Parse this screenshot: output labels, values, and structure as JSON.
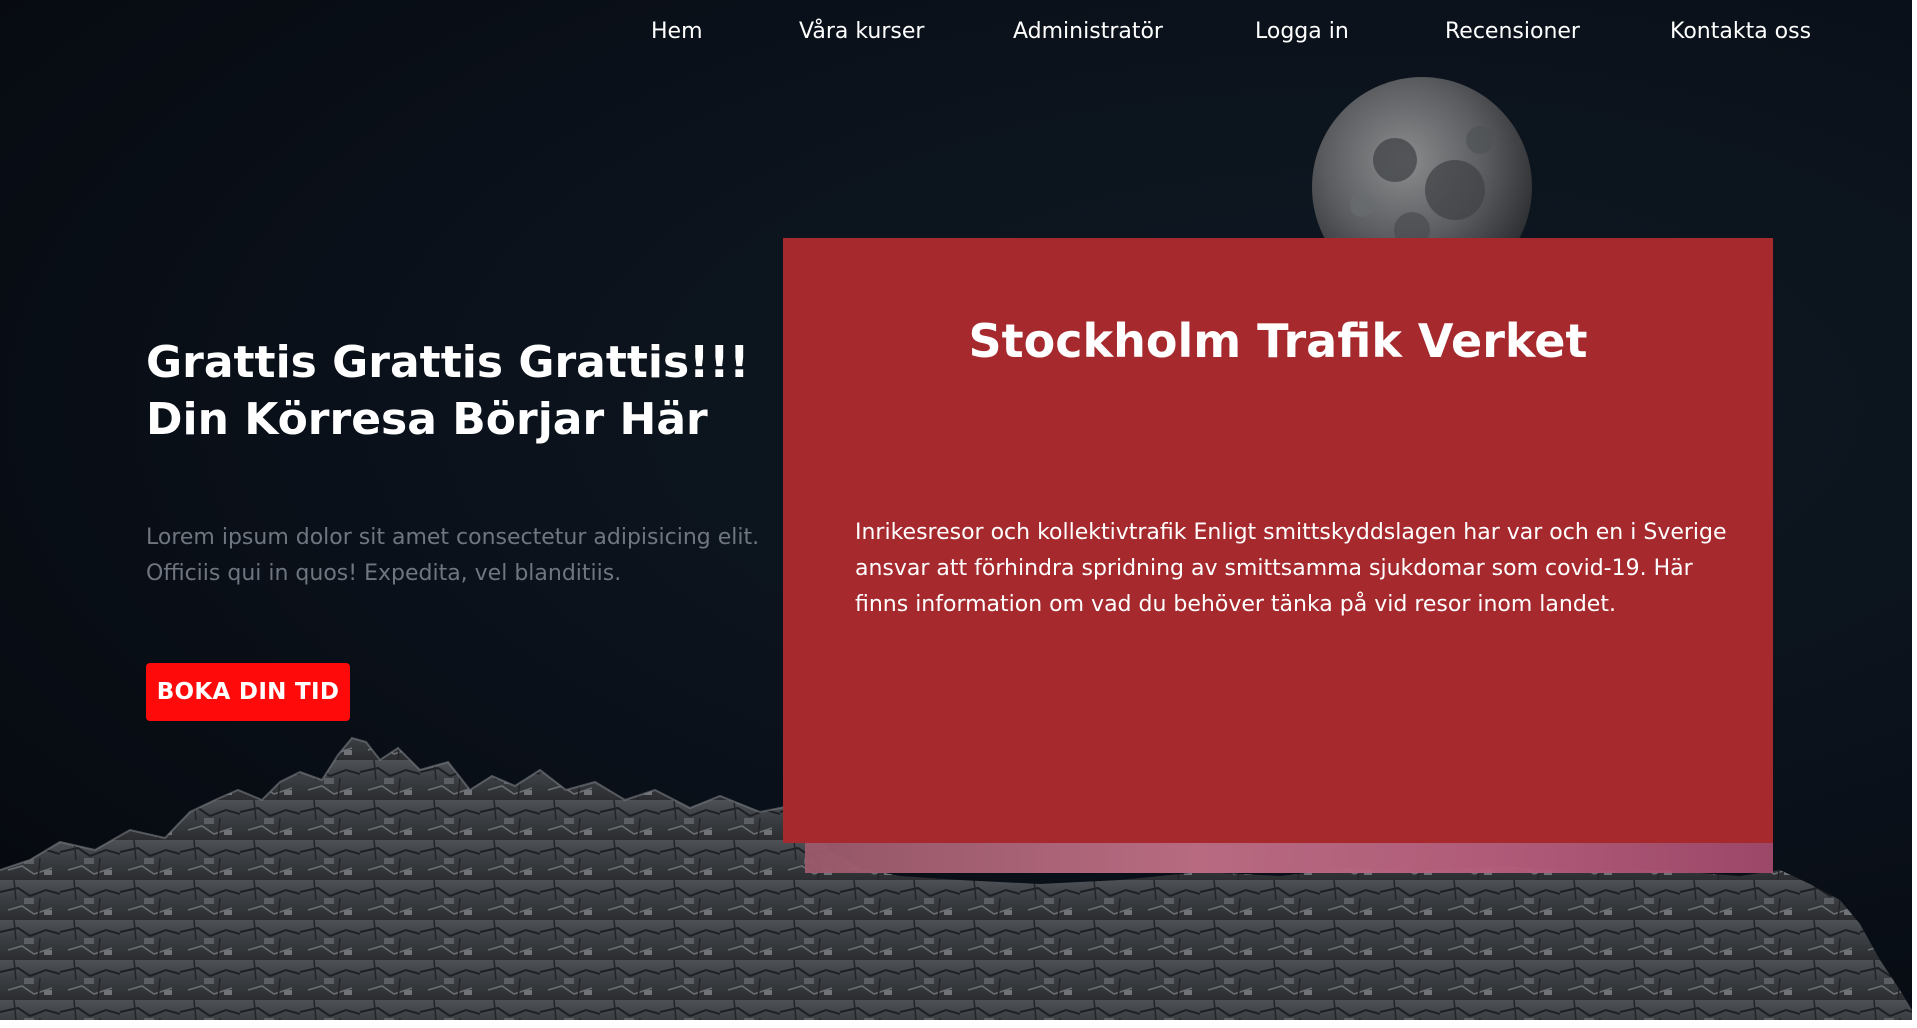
{
  "nav": {
    "items": [
      {
        "label": "Hem"
      },
      {
        "label": "Våra kurser"
      },
      {
        "label": "Administratör"
      },
      {
        "label": "Logga in"
      },
      {
        "label": "Recensioner"
      },
      {
        "label": "Kontakta oss"
      }
    ]
  },
  "hero": {
    "title_line1": "Grattis Grattis Grattis!!!",
    "title_line2": "Din Körresa Börjar Här",
    "text_line1": "Lorem ipsum dolor sit amet consectetur adipisicing elit.",
    "text_line2": "Officiis qui in quos! Expedita, vel blanditiis.",
    "button_label": "BOKA DIN TID"
  },
  "card": {
    "title": "Stockholm Trafik Verket",
    "text_line1": "Inrikesresor och kollektivtrafik Enligt smittskyddslagen har var och en i Sverige",
    "text_line2": "ansvar att förhindra spridning av smittsamma sjukdomar som covid-19. Här",
    "text_line3": "finns information om vad du behöver tänka på vid resor inom landet."
  },
  "colors": {
    "card_background": "#a6292e",
    "button_background": "#ff0a0a",
    "page_background": "#0a1019",
    "muted_text": "#6f7680"
  },
  "icons": {
    "moon": "moon-image",
    "rocks": "rocky-mountain-image"
  }
}
